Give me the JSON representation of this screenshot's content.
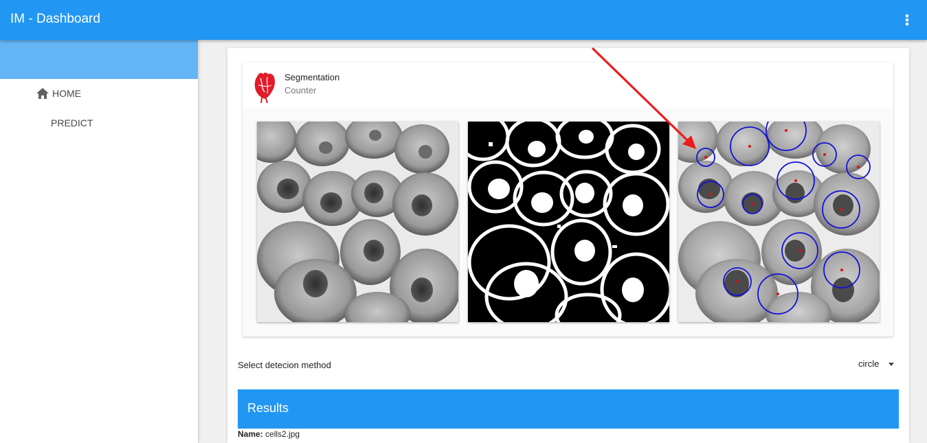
{
  "app": {
    "title": "IM - Dashboard",
    "menu_icon": "more-vert-icon"
  },
  "sidebar": {
    "items": [
      {
        "label": "HOME",
        "icon": "home-icon"
      },
      {
        "label": "PREDICT"
      }
    ]
  },
  "card": {
    "title": "Segmentation",
    "subtitle": "Counter",
    "avatar_icon": "heart-organ-icon",
    "images": [
      {
        "kind": "original-grayscale"
      },
      {
        "kind": "binary-threshold"
      },
      {
        "kind": "circle-detections"
      }
    ]
  },
  "detection": {
    "label": "Select detecion method",
    "selected": "circle"
  },
  "results": {
    "title": "Results",
    "name_label": "Name:",
    "name_value": "cells2.jpg"
  },
  "colors": {
    "appbar": "#2196f3",
    "drawer_header": "#64b5f6",
    "circle_stroke": "#1010d8",
    "center_dot": "#e01010",
    "annotation_arrow": "#ec1c1c"
  }
}
